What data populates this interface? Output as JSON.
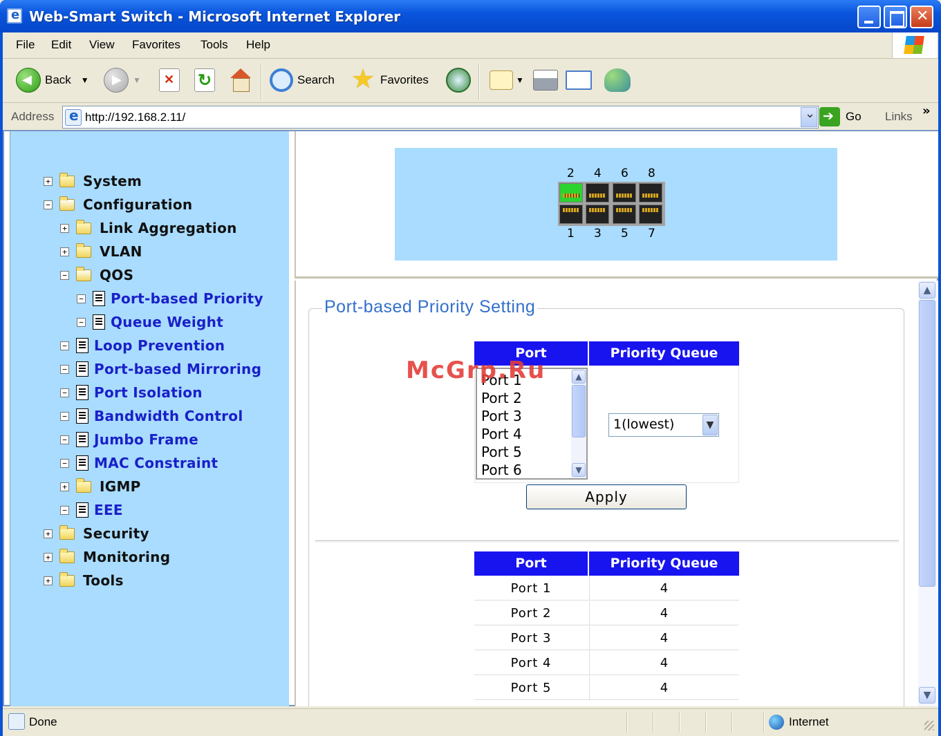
{
  "window": {
    "title": "Web-Smart Switch - Microsoft Internet Explorer"
  },
  "menu": [
    "File",
    "Edit",
    "View",
    "Favorites",
    "Tools",
    "Help"
  ],
  "toolbar": {
    "back": "Back",
    "search": "Search",
    "favorites": "Favorites"
  },
  "address": {
    "label": "Address",
    "url": "http://192.168.2.11/",
    "go": "Go",
    "links": "Links",
    "chevron": "»"
  },
  "nav": [
    {
      "label": "System",
      "type": "folder",
      "expander": "+",
      "link": false
    },
    {
      "label": "Configuration",
      "type": "folder-open",
      "expander": "−",
      "link": false
    },
    {
      "label": "Link Aggregation",
      "type": "folder",
      "expander": "+",
      "link": false
    },
    {
      "label": "VLAN",
      "type": "folder",
      "expander": "+",
      "link": false
    },
    {
      "label": "QOS",
      "type": "folder-open",
      "expander": "−",
      "link": false
    },
    {
      "label": "Port-based Priority",
      "type": "doc",
      "expander": "−",
      "link": true
    },
    {
      "label": "Queue Weight",
      "type": "doc",
      "expander": "−",
      "link": true
    },
    {
      "label": "Loop Prevention",
      "type": "doc",
      "expander": "−",
      "link": true
    },
    {
      "label": "Port-based Mirroring",
      "type": "doc",
      "expander": "−",
      "link": true
    },
    {
      "label": "Port Isolation",
      "type": "doc",
      "expander": "−",
      "link": true
    },
    {
      "label": "Bandwidth Control",
      "type": "doc",
      "expander": "−",
      "link": true
    },
    {
      "label": "Jumbo Frame",
      "type": "doc",
      "expander": "−",
      "link": true
    },
    {
      "label": "MAC Constraint",
      "type": "doc",
      "expander": "−",
      "link": true
    },
    {
      "label": "IGMP",
      "type": "folder",
      "expander": "+",
      "link": false
    },
    {
      "label": "EEE",
      "type": "doc",
      "expander": "−",
      "link": true
    },
    {
      "label": "Security",
      "type": "folder",
      "expander": "+",
      "link": false
    },
    {
      "label": "Monitoring",
      "type": "folder",
      "expander": "+",
      "link": false
    },
    {
      "label": "Tools",
      "type": "folder",
      "expander": "+",
      "link": false
    }
  ],
  "ports": {
    "top": [
      "2",
      "4",
      "6",
      "8"
    ],
    "bottom": [
      "1",
      "3",
      "5",
      "7"
    ],
    "active": "2"
  },
  "main": {
    "legend": "Port-based Priority Setting",
    "col_port": "Port",
    "col_queue": "Priority Queue",
    "port_options": [
      "Port 1",
      "Port 2",
      "Port 3",
      "Port 4",
      "Port 5",
      "Port 6"
    ],
    "selected_queue": "1(lowest)",
    "apply": "Apply",
    "results": [
      {
        "port": "Port 1",
        "queue": "4"
      },
      {
        "port": "Port 2",
        "queue": "4"
      },
      {
        "port": "Port 3",
        "queue": "4"
      },
      {
        "port": "Port 4",
        "queue": "4"
      },
      {
        "port": "Port 5",
        "queue": "4"
      }
    ]
  },
  "watermark": "McGrp.Ru",
  "status": {
    "text": "Done",
    "zone": "Internet"
  },
  "colors": {
    "header_blue": "#1814f0",
    "nav_bg": "#a9dcff",
    "link": "#1a20c8",
    "active_port": "#2bd42e"
  }
}
